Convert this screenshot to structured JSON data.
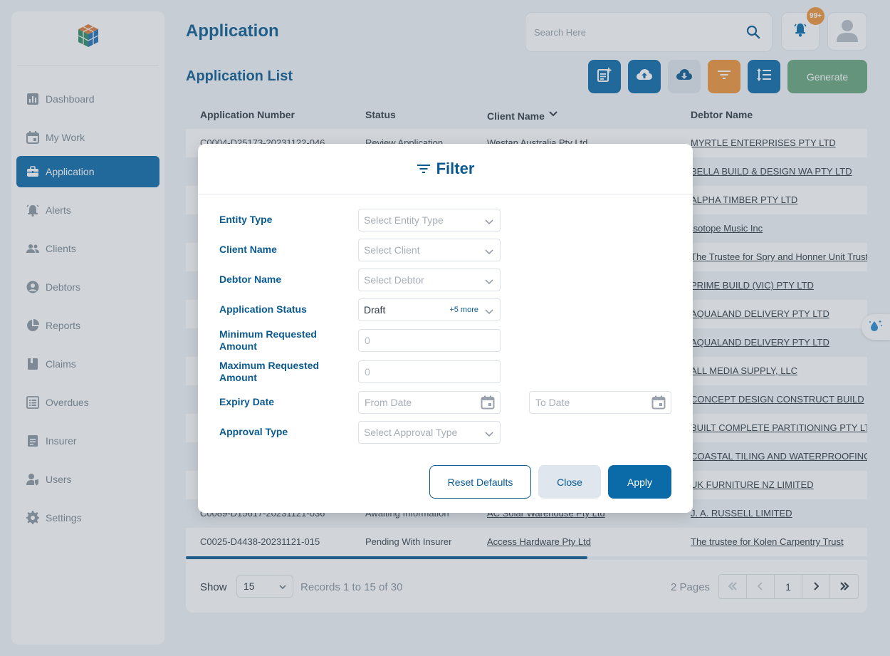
{
  "sidebar": {
    "items": [
      {
        "label": "Dashboard",
        "icon": "bar-chart-icon"
      },
      {
        "label": "My Work",
        "icon": "calendar-icon"
      },
      {
        "label": "Application",
        "icon": "briefcase-icon"
      },
      {
        "label": "Alerts",
        "icon": "alarm-icon"
      },
      {
        "label": "Clients",
        "icon": "people-icon"
      },
      {
        "label": "Debtors",
        "icon": "user-circle-icon"
      },
      {
        "label": "Reports",
        "icon": "pie-chart-icon"
      },
      {
        "label": "Claims",
        "icon": "book-icon"
      },
      {
        "label": "Overdues",
        "icon": "list-icon"
      },
      {
        "label": "Insurer",
        "icon": "document-icon"
      },
      {
        "label": "Users",
        "icon": "user-shield-icon"
      },
      {
        "label": "Settings",
        "icon": "gear-icon"
      }
    ],
    "active": "Application"
  },
  "header": {
    "title": "Application",
    "search_placeholder": "Search Here",
    "notification_badge": "99+"
  },
  "list": {
    "title": "Application List",
    "generate_label": "Generate",
    "columns": [
      "Application Number",
      "Status",
      "Client Name",
      "Debtor Name"
    ],
    "rows": [
      {
        "app": "C0004-D25173-20231122-046",
        "status": "Review Application",
        "client": "Westan Australia Pty Ltd",
        "debtor": "MYRTLE ENTERPRISES PTY LTD"
      },
      {
        "app": "",
        "status": "",
        "client": "",
        "debtor": "BELLA BUILD & DESIGN WA PTY LTD"
      },
      {
        "app": "",
        "status": "",
        "client": "",
        "debtor": "ALPHA TIMBER PTY LTD"
      },
      {
        "app": "",
        "status": "",
        "client": "",
        "debtor": "Isotope Music Inc"
      },
      {
        "app": "",
        "status": "",
        "client": "",
        "debtor": "The Trustee for Spry and Honner Unit Trust"
      },
      {
        "app": "",
        "status": "",
        "client": "",
        "debtor": "PRIME BUILD (VIC) PTY LTD"
      },
      {
        "app": "",
        "status": "",
        "client": "",
        "debtor": "AQUALAND DELIVERY PTY LTD"
      },
      {
        "app": "",
        "status": "",
        "client": "",
        "debtor": "AQUALAND DELIVERY PTY LTD"
      },
      {
        "app": "",
        "status": "",
        "client": "",
        "debtor": "ALL MEDIA SUPPLY, LLC"
      },
      {
        "app": "",
        "status": "",
        "client": "",
        "debtor": "CONCEPT DESIGN CONSTRUCT BUILD"
      },
      {
        "app": "",
        "status": "",
        "client": "",
        "debtor": "BUILT COMPLETE PARTITIONING PTY LTD"
      },
      {
        "app": "",
        "status": "",
        "client": "",
        "debtor": "COASTAL TILING AND WATERPROOFING"
      },
      {
        "app": "",
        "status": "",
        "client": "",
        "debtor": "UK FURNITURE NZ LIMITED"
      },
      {
        "app": "C0089-D15617-20231121-036",
        "status": "Awaiting Information",
        "client": "AC Solar Warehouse Pty Ltd",
        "debtor": "J. A. RUSSELL LIMITED"
      },
      {
        "app": "C0025-D4438-20231121-015",
        "status": "Pending With Insurer",
        "client": "Access Hardware Pty Ltd",
        "debtor": "The trustee for Kolen Carpentry Trust"
      }
    ]
  },
  "pagination": {
    "show_label": "Show",
    "page_size": "15",
    "records": "Records 1 to 15 of 30",
    "pages": "2 Pages",
    "current_page": "1"
  },
  "filter": {
    "title": "Filter",
    "fields": {
      "entity_type": {
        "label": "Entity Type",
        "placeholder": "Select Entity Type"
      },
      "client_name": {
        "label": "Client Name",
        "placeholder": "Select Client"
      },
      "debtor_name": {
        "label": "Debtor Name",
        "placeholder": "Select Debtor"
      },
      "application_status": {
        "label": "Application Status",
        "value": "Draft",
        "more": "+5 more"
      },
      "min_amount": {
        "label": "Minimum Requested Amount",
        "placeholder": "0"
      },
      "max_amount": {
        "label": "Maximum Requested Amount",
        "placeholder": "0"
      },
      "expiry_date": {
        "label": "Expiry Date",
        "from_placeholder": "From Date",
        "to_placeholder": "To Date"
      },
      "approval_type": {
        "label": "Approval Type",
        "placeholder": "Select Approval Type"
      }
    },
    "buttons": {
      "reset": "Reset Defaults",
      "close": "Close",
      "apply": "Apply"
    }
  },
  "colors": {
    "primary": "#0b6aa8",
    "accent": "#f0953a",
    "generate": "#6aa680"
  }
}
